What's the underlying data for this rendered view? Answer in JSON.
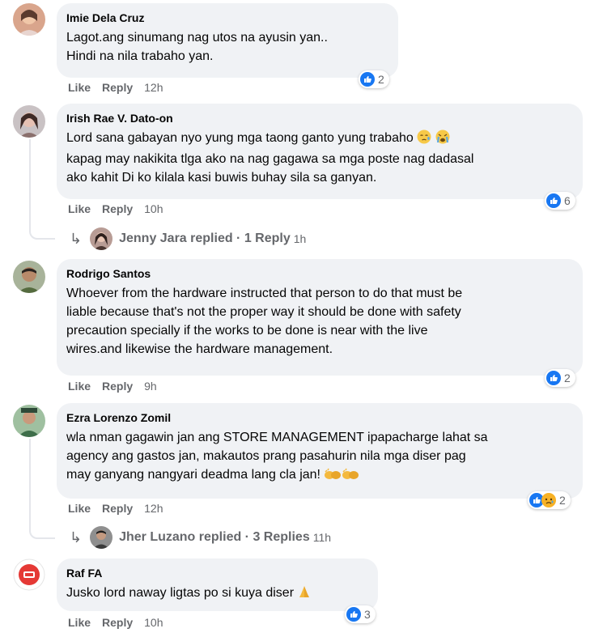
{
  "comments": [
    {
      "author": "Imie Dela Cruz",
      "lines": [
        "Lagot.ang sinumang nag utos na ayusin yan..",
        "Hindi na nila trabaho yan."
      ],
      "like": "Like",
      "reply": "Reply",
      "time": "12h",
      "reactions": {
        "icons": [
          "like-icon"
        ],
        "count": "2"
      }
    },
    {
      "author": "Irish Rae V. Dato-on",
      "lines": [
        "Lord sana gabayan nyo yung mga taong ganto yung trabaho",
        "kapag may nakikita tlga ako na nag gagawa sa mga poste nag dadasal",
        "ako kahit Di ko kilala kasi buwis buhay sila sa ganyan."
      ],
      "emojis": [
        "sleepy-face-emoji",
        "crying-face-emoji"
      ],
      "like": "Like",
      "reply": "Reply",
      "time": "10h",
      "reactions": {
        "icons": [
          "like-icon"
        ],
        "count": "6"
      },
      "replies": {
        "summary": "Jenny Jara replied · 1 Reply",
        "time": "1h"
      }
    },
    {
      "author": "Rodrigo Santos",
      "lines": [
        "Whoever from the hardware instructed that person to do that must be",
        "liable because that's not the proper way it should be done with safety",
        "precaution specially if the works to be done is near with the live",
        "wires.and likewise the hardware management."
      ],
      "like": "Like",
      "reply": "Reply",
      "time": "9h",
      "reactions": {
        "icons": [
          "like-icon"
        ],
        "count": "2"
      }
    },
    {
      "author": "Ezra Lorenzo Zomil",
      "lines": [
        "wla nman gagawin jan ang STORE MANAGEMENT ipapacharge lahat sa",
        "agency ang gastos jan, makautos prang pasahurin nila mga diser pag",
        "may ganyang nangyari deadma lang cla jan!"
      ],
      "emojis": [
        "clapping-hands-emoji",
        "clapping-hands-emoji"
      ],
      "like": "Like",
      "reply": "Reply",
      "time": "12h",
      "reactions": {
        "icons": [
          "like-icon",
          "sad-icon"
        ],
        "count": "2"
      },
      "replies": {
        "summary": "Jher Luzano replied · 3 Replies",
        "time": "11h"
      }
    },
    {
      "author": "Raf FA",
      "lines": [
        "Jusko lord naway ligtas po si kuya diser"
      ],
      "emojis": [
        "praying-hands-emoji"
      ],
      "like": "Like",
      "reply": "Reply",
      "time": "10h",
      "reactions": {
        "icons": [
          "like-icon"
        ],
        "count": "3"
      }
    }
  ],
  "colors": {
    "bubble": "#f0f2f5",
    "meta_text": "#65676b",
    "like_blue": "#1877f2",
    "sad_yellow": "#f7b125"
  }
}
